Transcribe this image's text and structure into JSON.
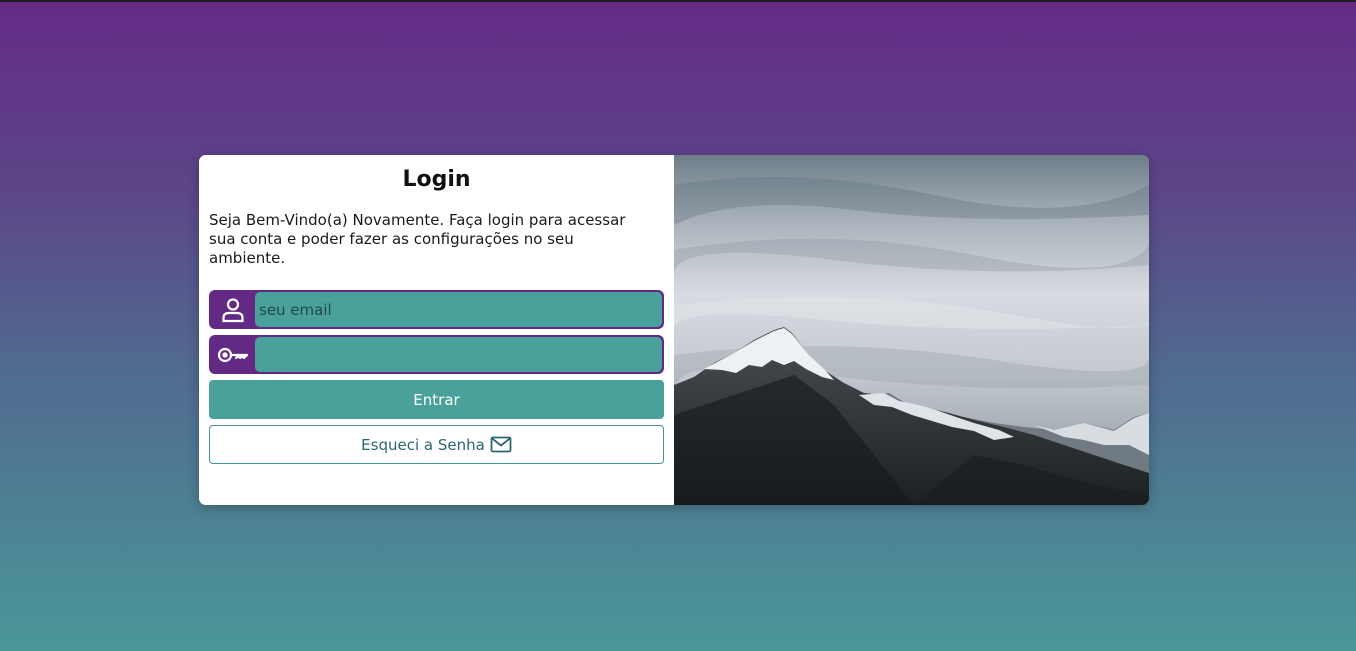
{
  "login": {
    "title": "Login",
    "welcome_text": "Seja Bem-Vindo(a) Novamente. Faça login para acessar sua conta e poder fazer as configurações no seu ambiente.",
    "email": {
      "placeholder": "seu email",
      "value": "",
      "icon": "user-icon"
    },
    "password": {
      "placeholder": "",
      "value": "",
      "icon": "key-icon"
    },
    "submit_label": "Entrar",
    "forgot_label": "Esqueci a Senha",
    "forgot_icon": "mail-icon"
  },
  "image": {
    "subject": "snowy mountain peak under cloudy sky"
  },
  "colors": {
    "purple": "#632a85",
    "teal": "#4aa19c",
    "outline": "#4a8f98"
  }
}
